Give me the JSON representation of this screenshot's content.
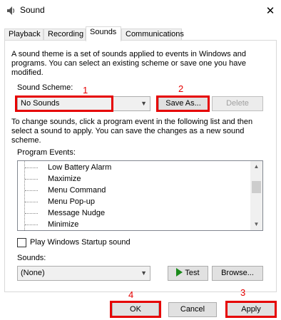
{
  "window": {
    "title": "Sound",
    "icon": "speaker-icon",
    "close_glyph": "✕"
  },
  "tabs": [
    {
      "label": "Playback"
    },
    {
      "label": "Recording"
    },
    {
      "label": "Sounds",
      "active": true
    },
    {
      "label": "Communications"
    }
  ],
  "sounds_tab": {
    "theme_description": "A sound theme is a set of sounds applied to events in Windows and programs.  You can select an existing scheme or save one you have modified.",
    "scheme_label": "Sound Scheme:",
    "scheme_value": "No Sounds",
    "save_as_label": "Save As...",
    "delete_label": "Delete",
    "change_description": "To change sounds, click a program event in the following list and then select a sound to apply.  You can save the changes as a new sound scheme.",
    "events_label": "Program Events:",
    "events": [
      "Low Battery Alarm",
      "Maximize",
      "Menu Command",
      "Menu Pop-up",
      "Message Nudge",
      "Minimize"
    ],
    "startup_label": "Play Windows Startup sound",
    "startup_checked": false,
    "sounds_label": "Sounds:",
    "sound_value": "(None)",
    "test_label": "Test",
    "browse_label": "Browse..."
  },
  "footer": {
    "ok_label": "OK",
    "cancel_label": "Cancel",
    "apply_label": "Apply"
  },
  "annotations": {
    "n1": "1",
    "n2": "2",
    "n3": "3",
    "n4": "4",
    "color": "#e60000"
  }
}
